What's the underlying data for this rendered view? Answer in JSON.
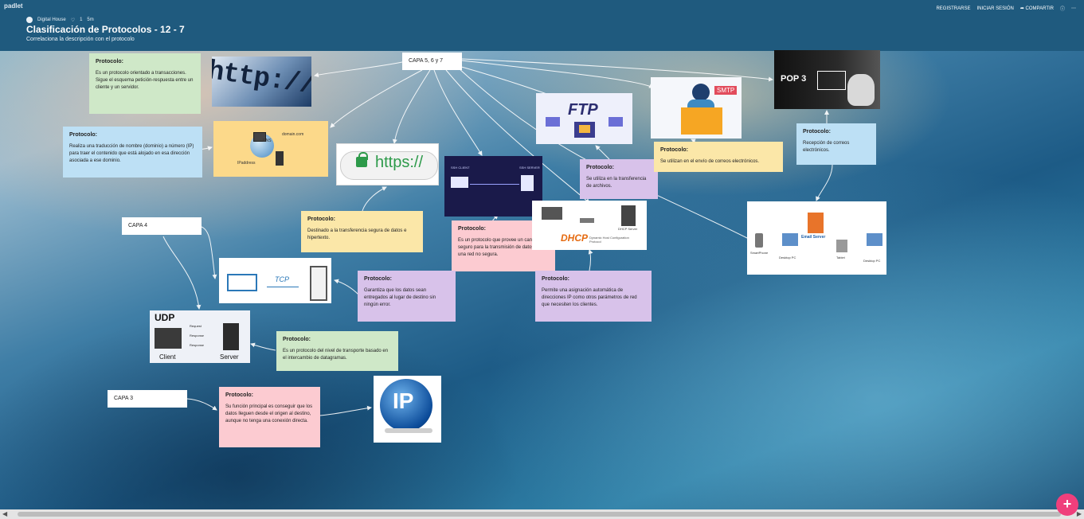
{
  "header": {
    "brand": "padlet",
    "author": "Digital House",
    "likes": "1",
    "time": "5m",
    "title": "Clasificación de Protocolos - 12 - 7",
    "subtitle": "Correlaciona la descripción con el protocolo",
    "nav": {
      "register": "REGISTRARSE",
      "login": "INICIAR SESIÓN",
      "share": "COMPARTIR"
    }
  },
  "layers": {
    "capa567": "CAPA 5, 6 y 7",
    "capa4": "CAPA 4",
    "capa3": "CAPA 3"
  },
  "cards": {
    "http": {
      "title": "Protocolo:",
      "text": "Es un protocolo orientado a transacciones. Sigue el esquema petición-respuesta entre un cliente y un servidor."
    },
    "dns": {
      "title": "Protocolo:",
      "text": "Realiza una traducción de nombre (dominio) a número (IP) para traer el contenido que está alojado en esa dirección asociada a ese dominio."
    },
    "https": {
      "title": "Protocolo:",
      "text": "Destinado a la transferencia segura de datos e hipertexto."
    },
    "ssh": {
      "title": "Protocolo:",
      "text": "Es un protocolo que provee un canal seguro para la transmisión de datos sobre una red no segura."
    },
    "ftp": {
      "title": "Protocolo:",
      "text": "Se utiliza en la transferencia de archivos."
    },
    "smtp": {
      "title": "Protocolo:",
      "text": "Se utilizan en el envío de correos electrónicos."
    },
    "pop3": {
      "title": "Protocolo:",
      "text": "Recepción de correos electrónicos."
    },
    "dhcp": {
      "title": "Protocolo:",
      "text": "Permite una asignación automática de direcciones IP como otros parámetros de red que necesiten los clientes."
    },
    "tcp": {
      "title": "Protocolo:",
      "text": "Garantiza que los datos sean entregados al lugar de destino sin ningún error."
    },
    "udp": {
      "title": "Protocolo:",
      "text": "Es un protocolo del nivel de transporte basado en el intercambio de datagramas."
    },
    "ip": {
      "title": "Protocolo:",
      "text": "Su función principal es conseguir que los datos lleguen desde el origen al destino, aunque no tenga una conexión directa."
    }
  },
  "images": {
    "http": {
      "text": "http://ww"
    },
    "dns": {
      "label1": "domain.com",
      "label2": "DNS",
      "label3": "IPaddress"
    },
    "https": {
      "text": "https://"
    },
    "ssh": {
      "left": "SSH CLIENT",
      "right": "SSH SERVER"
    },
    "ftp": {
      "text": "FTP"
    },
    "smtp": {
      "text": "SMTP"
    },
    "pop3": {
      "text": "POP 3"
    },
    "dhcp": {
      "text": "DHCP",
      "server": "DHCP Server",
      "sub": "Dynamic Host Configuration Protocol"
    },
    "email": {
      "server": "Email Server",
      "smartphone": "SmartPhone",
      "desktop1": "Desktop PC",
      "tablet": "Tablet",
      "desktop2": "Desktop PC"
    },
    "tcp": {
      "text": "TCP"
    },
    "udp": {
      "text": "UDP",
      "client": "Client",
      "server": "Server",
      "request": "Request",
      "response": "Response",
      "response2": "Response"
    },
    "ip": {
      "text": "IP"
    }
  },
  "colors": {
    "header": "#1f5a7e",
    "fab": "#ef3f7c",
    "green": "#cfe8c8",
    "blue": "#bde0f5",
    "yellow": "#fbe7a8",
    "purple": "#d8c2ea",
    "pink": "#fccbd1"
  }
}
